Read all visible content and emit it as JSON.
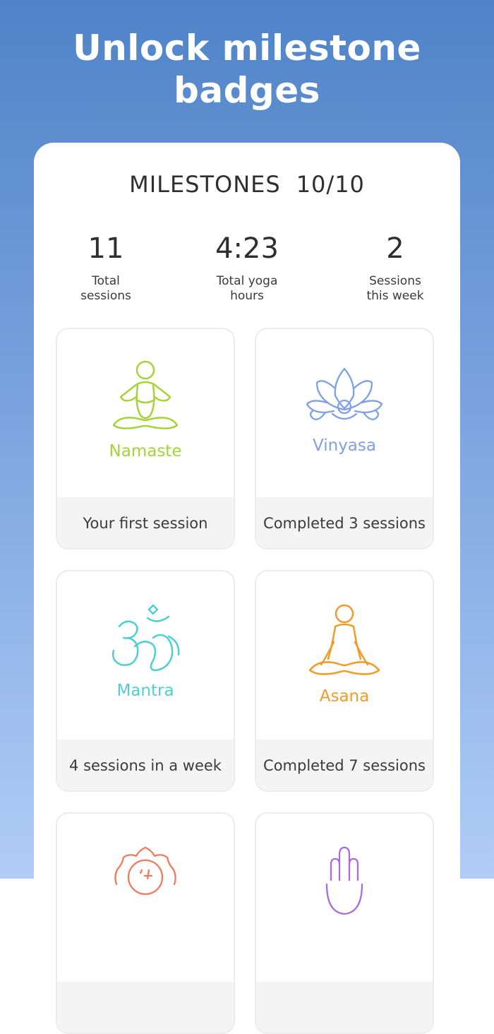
{
  "headline": "Unlock milestone badges",
  "milestones": {
    "title": "MILESTONES",
    "count": "10/10"
  },
  "stats": [
    {
      "value": "11",
      "label": "Total\nsessions"
    },
    {
      "value": "4:23",
      "label": "Total yoga\nhours"
    },
    {
      "value": "2",
      "label": "Sessions\nthis week"
    }
  ],
  "badges": [
    {
      "name": "Namaste",
      "description": "Your first session",
      "icon": "meditating-person-icon",
      "color": "#a6d23a"
    },
    {
      "name": "Vinyasa",
      "description": "Completed 3 sessions",
      "icon": "lotus-icon",
      "color": "#7f9fe6"
    },
    {
      "name": "Mantra",
      "description": "4 sessions in a week",
      "icon": "om-icon",
      "color": "#4fcfd0"
    },
    {
      "name": "Asana",
      "description": "Completed 7 sessions",
      "icon": "meditating-person-icon",
      "color": "#f39a2b"
    },
    {
      "name": "",
      "description": "",
      "icon": "mandala-icon",
      "color": "#f07a5a"
    },
    {
      "name": "",
      "description": "",
      "icon": "hamsa-hand-icon",
      "color": "#a86ce0"
    }
  ]
}
